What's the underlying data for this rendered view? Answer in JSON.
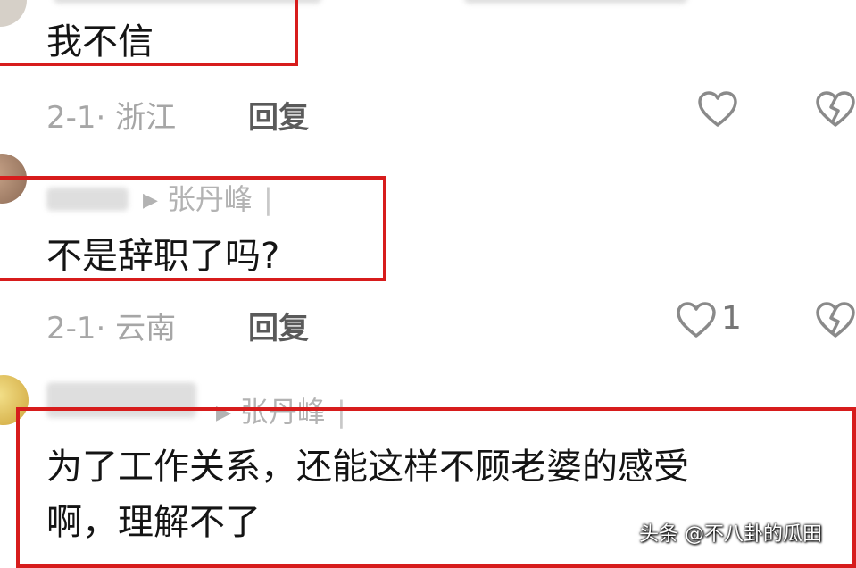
{
  "comments": [
    {
      "reply_to": "",
      "text": "我不信",
      "date_loc": "2-1· 浙江",
      "reply_label": "回复",
      "likes": ""
    },
    {
      "reply_to": "张丹峰",
      "text": "不是辞职了吗?",
      "date_loc": "2-1· 云南",
      "reply_label": "回复",
      "likes": "1"
    },
    {
      "reply_to": "张丹峰",
      "text_line1": "为了工作关系，还能这样不顾老婆的感受",
      "text_line2": "啊，理解不了",
      "date_loc": "",
      "reply_label": "",
      "likes": ""
    }
  ],
  "watermark": "头条 @不八卦的瓜田",
  "colors": {
    "highlight": "#d71c1c",
    "meta": "#a6a6a6",
    "text": "#141414"
  },
  "icons": [
    "heart-icon",
    "broken-heart-icon"
  ]
}
